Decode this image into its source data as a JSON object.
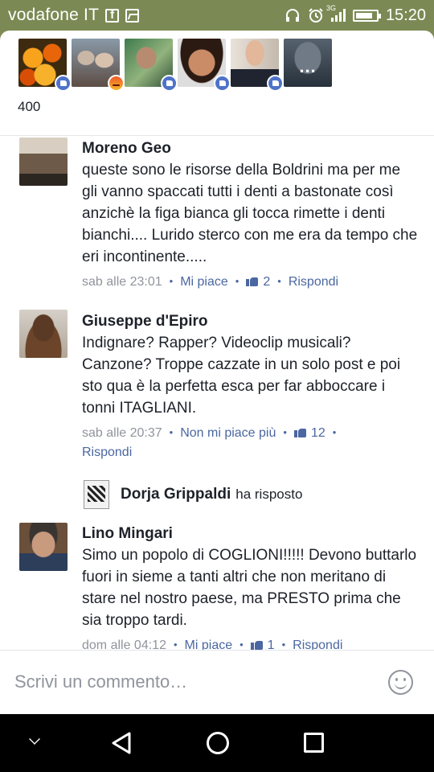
{
  "status_bar": {
    "carrier": "vodafone IT",
    "network": "3G",
    "time": "15:20",
    "icons": [
      "facebook-notification-icon",
      "gallery-notification-icon",
      "headset-icon",
      "alarm-icon",
      "signal-icon",
      "battery-icon"
    ]
  },
  "reactions": {
    "reactors": [
      {
        "name": "reactor-1",
        "reaction": "like"
      },
      {
        "name": "reactor-2",
        "reaction": "angry"
      },
      {
        "name": "reactor-3",
        "reaction": "like"
      },
      {
        "name": "reactor-4",
        "reaction": "like"
      },
      {
        "name": "reactor-5",
        "reaction": "like"
      },
      {
        "name": "reactor-more",
        "reaction": "",
        "more_label": "..."
      }
    ],
    "count": "400"
  },
  "comments": [
    {
      "author": "Moreno Geo",
      "text": "queste sono le risorse della Boldrini ma per me gli vanno spaccati tutti i denti a bastonate così anzichè la figa bianca gli tocca rimette i denti bianchi.... Lurido sterco con me era da tempo che eri incontinente.....",
      "time": "sab alle 23:01",
      "like_label": "Mi piace",
      "likes": "2",
      "reply_label": "Rispondi"
    },
    {
      "author": "Giuseppe d'Epiro",
      "text": "Indignare? Rapper? Videoclip musicali? Canzone? Troppe cazzate in un solo post e poi sto qua è la perfetta esca per far abboccare i tonni ITAGLIANI.",
      "time": "sab alle 20:37",
      "like_label": "Non mi piace più",
      "likes": "12",
      "reply_label": "Rispondi",
      "reply_preview": {
        "author": "Dorja Grippaldi",
        "verb": "ha risposto"
      }
    },
    {
      "author": "Lino Mingari",
      "text": "Simo un popolo di COGLIONI!!!!! Devono buttarlo fuori in sieme a tanti altri che non meritano di stare nel nostro paese, ma PRESTO prima che sia troppo tardi.",
      "time": "dom alle 04:12",
      "like_label": "Mi piace",
      "likes": "1",
      "reply_label": "Rispondi"
    }
  ],
  "composer": {
    "placeholder": "Scrivi un commento…"
  },
  "colors": {
    "status_bar": "#7b8a54",
    "link": "#4b67a1",
    "meta": "#90949c",
    "like_badge": "#4f73c9"
  }
}
